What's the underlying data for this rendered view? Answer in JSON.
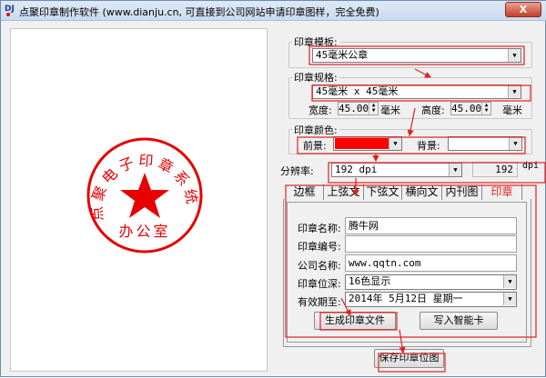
{
  "window": {
    "title": "点聚印章制作软件 (www.dianju.cn, 可直接到公司网站申请印章图样，完全免费)",
    "icon": "DJ",
    "close_label": "X"
  },
  "stamp": {
    "ring_text": "点聚电子印章系统",
    "center_text": "办公室",
    "star_icon": "star-icon",
    "color": "#e60000"
  },
  "template": {
    "label": "印章模板:",
    "value": "45毫米公章"
  },
  "spec": {
    "label": "印章规格:",
    "value": "45毫米 x 45毫米",
    "width_label": "宽度:",
    "width_value": "45.00",
    "height_label": "高度:",
    "height_value": "45.00",
    "unit": "毫米"
  },
  "color": {
    "label": "印章颜色:",
    "fg_label": "前景:",
    "fg_color": "#ff0000",
    "bg_label": "背景:",
    "bg_color": "#ffffff"
  },
  "resolution": {
    "label": "分辨率:",
    "value": "192 dpi",
    "number": "192",
    "unit": "dpi"
  },
  "tabs": [
    {
      "label": "边框"
    },
    {
      "label": "上弦文"
    },
    {
      "label": "下弦文"
    },
    {
      "label": "横向文"
    },
    {
      "label": "内刊图"
    },
    {
      "label": "印章",
      "active": true
    }
  ],
  "form": {
    "name_label": "印章名称:",
    "name_value": "腾牛网",
    "number_label": "印章编号:",
    "number_value": "",
    "company_label": "公司名称:",
    "company_value": "www.qqtn.com",
    "depth_label": "印章位深:",
    "depth_value": "16色显示",
    "expiry_label": "有效期至:",
    "expiry_value": "2014年 5月12日 星期一"
  },
  "buttons": {
    "generate": "生成印章文件",
    "write_card": "写入智能卡",
    "save_bitmap": "保存印章位图"
  },
  "annotation_color": "#e02020"
}
